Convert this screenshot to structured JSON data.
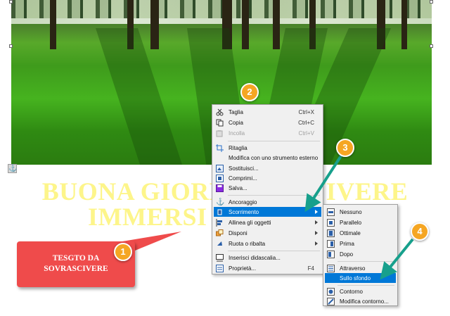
{
  "headline": {
    "line1": "BUONA GIORNATA E VIVERE",
    "line2": "IMMERSI NEL VERDE"
  },
  "callout": {
    "line1": "TESGTO DA",
    "line2": "SOVRASCIVERE"
  },
  "badges": [
    "1",
    "2",
    "3",
    "4"
  ],
  "context_menu": {
    "items": [
      {
        "label": "Taglia",
        "shortcut": "Ctrl+X",
        "icon": "scissors-icon"
      },
      {
        "label": "Copia",
        "shortcut": "Ctrl+C",
        "icon": "copy-icon"
      },
      {
        "label": "Incolla",
        "shortcut": "Ctrl+V",
        "icon": "paste-icon",
        "disabled": true
      },
      {
        "label": "Ritaglia",
        "icon": "crop-icon"
      },
      {
        "label": "Modifica con uno strumento esterno",
        "icon": ""
      },
      {
        "label": "Sostituisci...",
        "icon": "replace-image-icon"
      },
      {
        "label": "Comprimi...",
        "icon": "compress-icon"
      },
      {
        "label": "Salva...",
        "icon": "save-icon"
      },
      {
        "label": "Ancoraggio",
        "icon": "anchor-icon",
        "submenu": true
      },
      {
        "label": "Scorrimento",
        "icon": "wrap-icon",
        "submenu": true,
        "selected": true
      },
      {
        "label": "Allinea gli oggetti",
        "icon": "align-icon",
        "submenu": true
      },
      {
        "label": "Disponi",
        "icon": "arrange-icon",
        "submenu": true
      },
      {
        "label": "Ruota o ribalta",
        "icon": "rotate-icon",
        "submenu": true
      },
      {
        "label": "Inserisci didascalia...",
        "icon": "caption-icon"
      },
      {
        "label": "Proprietà...",
        "shortcut": "F4",
        "icon": "properties-icon"
      }
    ]
  },
  "wrap_submenu": {
    "items": [
      {
        "label": "Nessuno",
        "icon": "wrap-none-icon"
      },
      {
        "label": "Parallelo",
        "icon": "wrap-parallel-icon"
      },
      {
        "label": "Ottimale",
        "icon": "wrap-optimal-icon"
      },
      {
        "label": "Prima",
        "icon": "wrap-before-icon"
      },
      {
        "label": "Dopo",
        "icon": "wrap-after-icon"
      },
      {
        "label": "Attraverso",
        "icon": "wrap-through-icon"
      },
      {
        "label": "Sullo sfondo",
        "icon": "",
        "selected": true
      },
      {
        "label": "Contorno",
        "icon": "contour-icon"
      },
      {
        "label": "Modifica contorno...",
        "icon": "edit-contour-icon"
      }
    ]
  },
  "colors": {
    "menu_highlight": "#0078d7",
    "callout": "#ef4b4b",
    "badge": "#f5a623",
    "headline": "#fdf58a",
    "arrow": "#17a08c"
  }
}
